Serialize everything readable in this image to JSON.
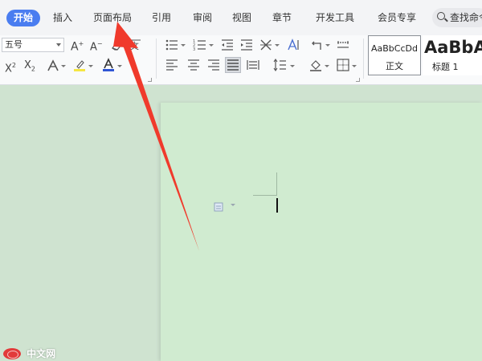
{
  "menu": {
    "tabs": [
      {
        "label": "开始",
        "active": true
      },
      {
        "label": "插入"
      },
      {
        "label": "页面布局"
      },
      {
        "label": "引用"
      },
      {
        "label": "审阅"
      },
      {
        "label": "视图"
      },
      {
        "label": "章节"
      },
      {
        "label": "开发工具"
      },
      {
        "label": "会员专享"
      }
    ],
    "search_label": "查找命令"
  },
  "ribbon": {
    "font_size": "五号",
    "styles": [
      {
        "preview": "AaBbCcDd",
        "name": "正文",
        "selected": true
      },
      {
        "preview": "AaBbA",
        "name": "标题 1"
      }
    ]
  },
  "colors": {
    "accent": "#4a7df0",
    "highlight": "#f5e642",
    "font_color_underline": "#2f55d4",
    "annotation_arrow": "#f03a2c",
    "page": "#d0ebd0"
  },
  "icons": [
    "grow-font-icon",
    "shrink-font-icon",
    "clear-format-icon",
    "phonetic-icon",
    "superscript-icon",
    "subscript-icon",
    "text-effect-icon",
    "highlight-icon",
    "font-color-icon",
    "bullet-list-icon",
    "numbered-list-icon",
    "decrease-indent-icon",
    "increase-indent-icon",
    "chinese-layout-icon",
    "sort-icon",
    "show-marks-icon",
    "align-left-icon",
    "align-center-icon",
    "align-right-icon",
    "justify-icon",
    "distributed-icon",
    "line-spacing-icon",
    "shading-icon",
    "border-icon",
    "paste-options-icon",
    "search-icon"
  ],
  "watermark": {
    "text": "中文网"
  }
}
